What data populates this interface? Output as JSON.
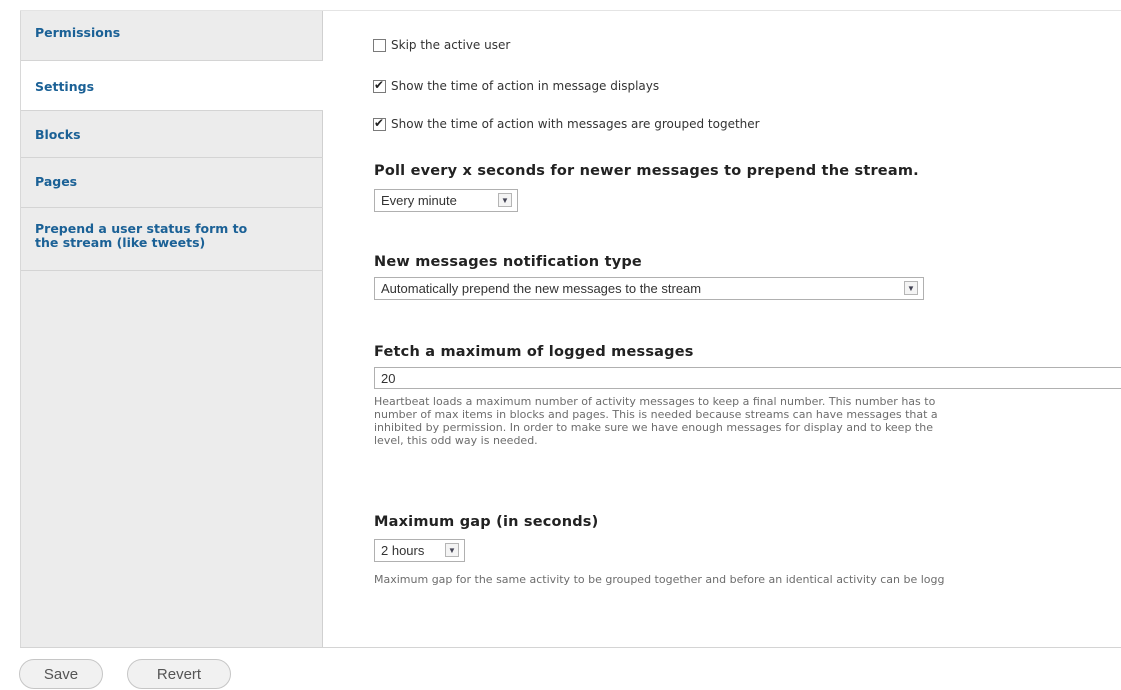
{
  "tabs": [
    {
      "label": "Permissions"
    },
    {
      "label": "Settings"
    },
    {
      "label": "Blocks"
    },
    {
      "label": "Pages"
    },
    {
      "label_line1": "Prepend a user status form to",
      "label_line2": "the stream (like tweets)"
    }
  ],
  "active_tab": "Settings",
  "checkboxes": [
    {
      "label": "Skip the active user",
      "checked": false
    },
    {
      "label": "Show the time of action in message displays",
      "checked": true
    },
    {
      "label": "Show the time of action with messages are grouped together",
      "checked": true
    }
  ],
  "poll": {
    "heading": "Poll every x seconds for newer messages to prepend the stream.",
    "value": "Every minute"
  },
  "notification": {
    "heading": "New messages notification type",
    "value": "Automatically prepend the new messages to the stream"
  },
  "fetch": {
    "heading": "Fetch a maximum of logged messages",
    "value": "20",
    "description_lines": [
      "Heartbeat loads a maximum number of activity messages to keep a final number. This number has to",
      "number of max items in blocks and pages. This is needed because streams can have messages that a",
      "inhibited by permission. In order to make sure we have enough messages for display and to keep the",
      "level, this odd way is needed."
    ]
  },
  "gap": {
    "heading": "Maximum gap (in seconds)",
    "value": "2 hours",
    "description": "Maximum gap for the same activity to be grouped together and before an identical activity can be logg"
  },
  "buttons": {
    "save": "Save",
    "revert": "Revert"
  }
}
